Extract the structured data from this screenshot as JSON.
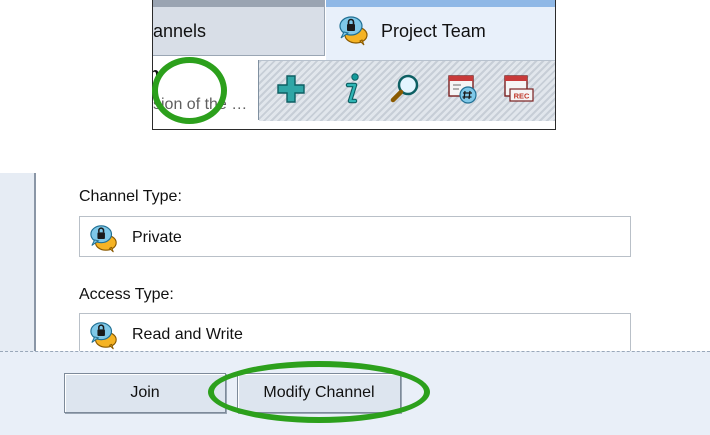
{
  "tabs": [
    {
      "label": "annels",
      "active": false
    },
    {
      "label": "Project Team",
      "active": true,
      "icon": "locked-chat-icon"
    }
  ],
  "channel_description": {
    "name": "n",
    "text": "sion of the …"
  },
  "toolbar": {
    "buttons": [
      {
        "icon": "add-icon"
      },
      {
        "icon": "info-icon",
        "highlighted": true
      },
      {
        "icon": "search-icon"
      },
      {
        "icon": "channel-number-icon"
      },
      {
        "icon": "record-icon",
        "badge": "REC"
      }
    ]
  },
  "details": {
    "channel_type_label": "Channel Type:",
    "channel_type_value": "Private",
    "access_type_label": "Access Type:",
    "access_type_value": "Read and Write"
  },
  "footer": {
    "join_label": "Join",
    "modify_label": "Modify Channel"
  },
  "colors": {
    "highlight": "#2ca01c",
    "active_tab_bg": "#e8f0fa",
    "toolbar_accent": "#30a6a6"
  }
}
